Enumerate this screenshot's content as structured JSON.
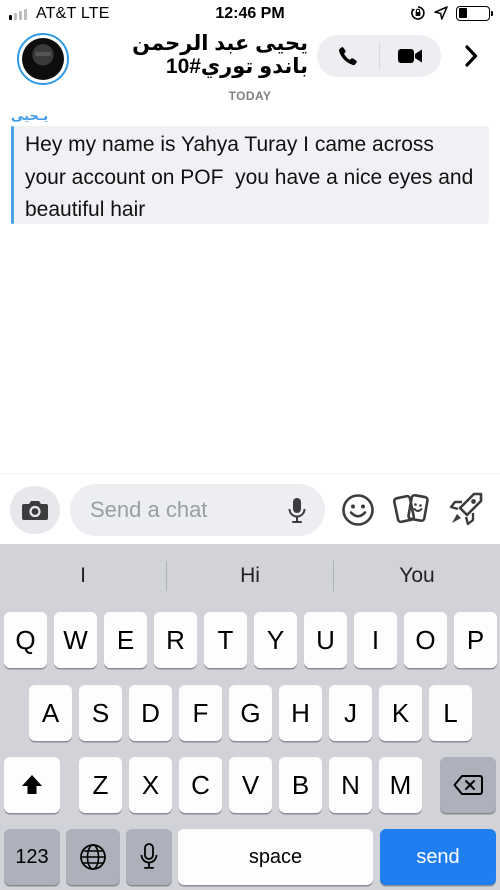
{
  "status_bar": {
    "carrier": "AT&T  LTE",
    "time": "12:46 PM",
    "signal_bars": 4,
    "signal_bars_active": 1,
    "battery_level": 0.28
  },
  "header": {
    "contact_name": "يحيى عبد الرحمن باندو توري#10",
    "date_divider": "TODAY"
  },
  "message": {
    "sender": "يـحيى",
    "text": "Hey my name is Yahya Turay I came across your account on POF  you have a nice eyes and beautiful hair"
  },
  "chat_input": {
    "placeholder": "Send a chat"
  },
  "keyboard": {
    "suggestions": [
      "I",
      "Hi",
      "You"
    ],
    "row1": [
      "Q",
      "W",
      "E",
      "R",
      "T",
      "Y",
      "U",
      "I",
      "O",
      "P"
    ],
    "row2": [
      "A",
      "S",
      "D",
      "F",
      "G",
      "H",
      "J",
      "K",
      "L"
    ],
    "row3": [
      "Z",
      "X",
      "C",
      "V",
      "B",
      "N",
      "M"
    ],
    "numbers_key": "123",
    "space_key": "space",
    "send_key": "send"
  },
  "colors": {
    "accent_blue": "#2f9be7",
    "send_blue": "#1f7ff2",
    "bubble_bg": "#f0f1f4",
    "keyboard_bg": "#d1d3d9"
  },
  "icons": {
    "camera": "camera-icon",
    "mic": "microphone-icon",
    "emoji": "smiley-icon",
    "stickers": "cards-icon",
    "games": "rocket-icon",
    "call": "phone-icon",
    "video": "video-icon",
    "forward": "chevron-right-icon",
    "shift": "shift-icon",
    "backspace": "backspace-icon",
    "globe": "globe-icon"
  }
}
